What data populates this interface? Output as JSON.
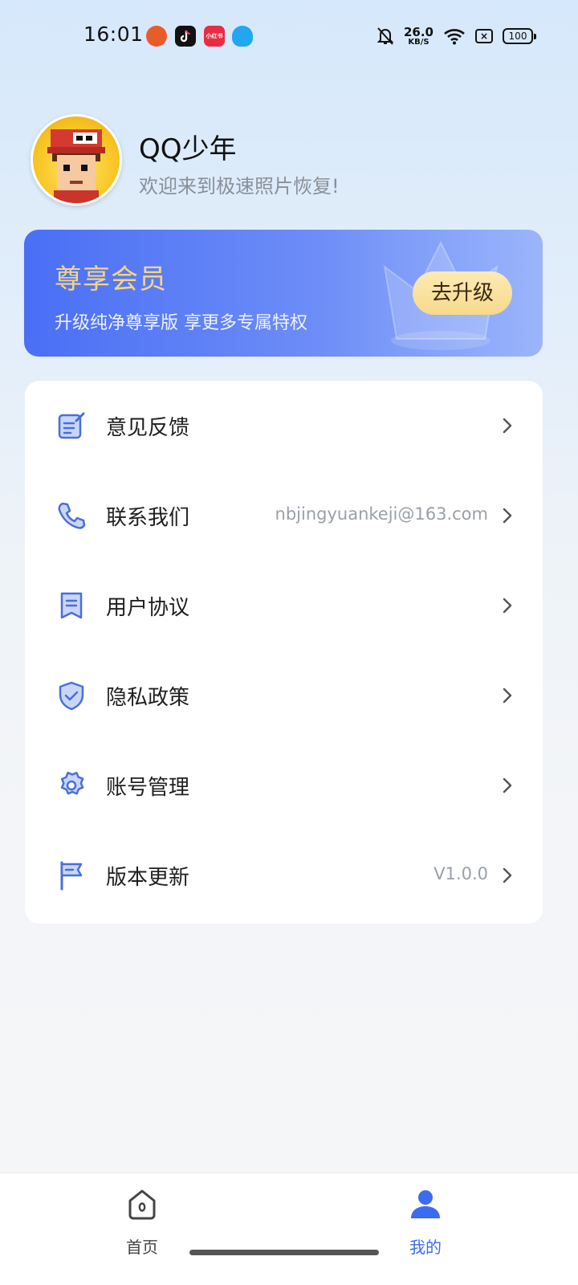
{
  "status_bar": {
    "time": "16:01",
    "app_icons": [
      "taobao-icon",
      "tiktok-icon",
      "xiaohongshu-icon",
      "qq-icon"
    ],
    "xiaohongshu_text": "小红书",
    "net_speed_value": "26.0",
    "net_speed_unit": "KB/S",
    "battery": "100",
    "icons": [
      "bell-off-icon",
      "wifi-icon",
      "sim-off-icon",
      "battery-icon"
    ]
  },
  "profile": {
    "name": "QQ少年",
    "subtitle": "欢迎来到极速照片恢复!"
  },
  "vip": {
    "title": "尊享会员",
    "description": "升级纯净尊享版 享更多专属特权",
    "button": "去升级"
  },
  "menu": {
    "items": [
      {
        "label": "意见反馈",
        "value": "",
        "icon": "feedback-icon"
      },
      {
        "label": "联系我们",
        "value": "nbjingyuankeji@163.com",
        "icon": "phone-icon"
      },
      {
        "label": "用户协议",
        "value": "",
        "icon": "agreement-icon"
      },
      {
        "label": "隐私政策",
        "value": "",
        "icon": "shield-icon"
      },
      {
        "label": "账号管理",
        "value": "",
        "icon": "gear-icon"
      },
      {
        "label": "版本更新",
        "value": "V1.0.0",
        "icon": "flag-icon"
      }
    ]
  },
  "bottom_nav": {
    "items": [
      {
        "label": "首页",
        "icon": "home-icon",
        "active": false
      },
      {
        "label": "我的",
        "icon": "user-icon",
        "active": true
      }
    ]
  },
  "colors": {
    "accent": "#3d6bf0",
    "vip_gold": "#f5d680",
    "icon_blue": "#4a6fd8",
    "muted_text": "#9aa0a8"
  }
}
